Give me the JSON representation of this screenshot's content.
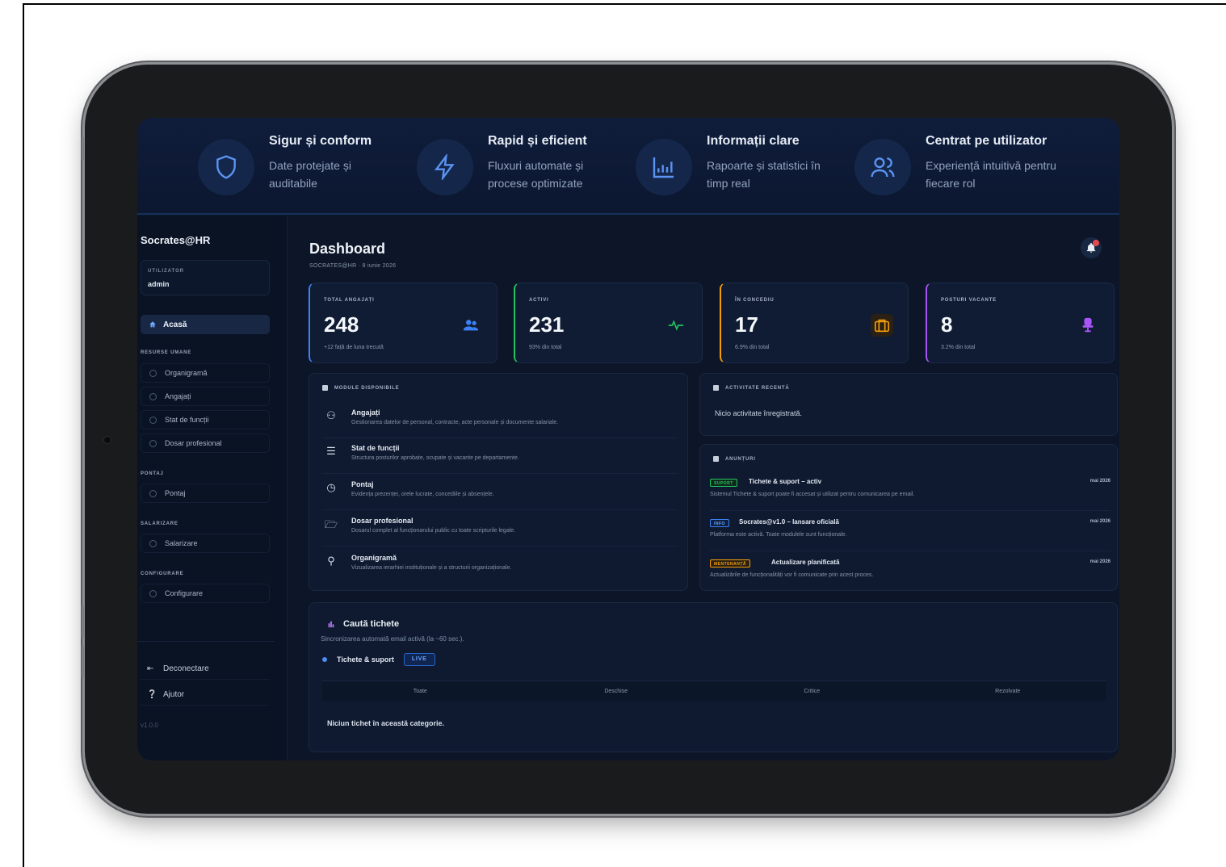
{
  "features": [
    {
      "icon": "shield-icon",
      "title": "Sigur și conform",
      "desc": "Date protejate și auditabile"
    },
    {
      "icon": "lightning-icon",
      "title": "Rapid și eficient",
      "desc": "Fluxuri automate și procese optimizate"
    },
    {
      "icon": "bar-chart-icon",
      "title": "Informații clare",
      "desc": "Rapoarte și statistici în timp real"
    },
    {
      "icon": "users-icon",
      "title": "Centrat pe utilizator",
      "desc": "Experiență intuitivă pentru fiecare rol"
    }
  ],
  "sidebar": {
    "brand": "Socrates@HR",
    "user_label": "UTILIZATOR",
    "user_value": "admin",
    "home": "Acasă",
    "sections": [
      {
        "title": "RESURSE UMANE",
        "items": [
          "Organigramă",
          "Angajați",
          "Stat de funcții",
          "Dosar profesional"
        ]
      },
      {
        "title": "PONTAJ",
        "items": [
          "Pontaj"
        ]
      },
      {
        "title": "SALARIZARE",
        "items": [
          "Salarizare"
        ]
      },
      {
        "title": "CONFIGURARE",
        "items": [
          "Configurare"
        ]
      }
    ],
    "logout": "Deconectare",
    "help": "Ajutor",
    "version": "v1.0.0"
  },
  "header": {
    "title": "Dashboard",
    "subtitle": "SOCRATES@HR · 8 iunie 2026"
  },
  "stats": [
    {
      "label": "TOTAL ANGAJAȚI",
      "value": "248",
      "note": "+12 față de luna trecută",
      "accent": "#3b82f6",
      "icon": "users-icon"
    },
    {
      "label": "ACTIVI",
      "value": "231",
      "note": "93% din total",
      "accent": "#22c55e",
      "icon": "activity-icon"
    },
    {
      "label": "ÎN CONCEDIU",
      "value": "17",
      "note": "6.9% din total",
      "accent": "#f59e0b",
      "icon": "briefcase-icon"
    },
    {
      "label": "POSTURI VACANTE",
      "value": "8",
      "note": "3.2% din total",
      "accent": "#a855f7",
      "icon": "chair-icon"
    }
  ],
  "modules": {
    "heading": "MODULE DISPONIBILE",
    "items": [
      {
        "icon": "people-icon",
        "title": "Angajați",
        "desc": "Gestionarea datelor de personal, contracte, acte personale și documente salariale."
      },
      {
        "icon": "list-icon",
        "title": "Stat de funcții",
        "desc": "Structura posturilor aprobate, ocupate și vacante pe departamente."
      },
      {
        "icon": "clock-icon",
        "title": "Pontaj",
        "desc": "Evidența prezenței, orele lucrate, concediile și absențele."
      },
      {
        "icon": "folder-icon",
        "title": "Dosar profesional",
        "desc": "Dosarul complet al funcționarului public cu toate scripturile legale."
      },
      {
        "icon": "org-chart-icon",
        "title": "Organigramă",
        "desc": "Vizualizarea ierarhiei instituționale și a structurii organizaționale."
      }
    ]
  },
  "activity": {
    "heading": "ACTIVITATE RECENTĂ",
    "empty": "Nicio activitate înregistrată."
  },
  "announcements": {
    "heading": "ANUNȚURI",
    "items": [
      {
        "tag": "SUPORT",
        "tag_color": "#22c55e",
        "title": "Tichete & suport – activ",
        "desc": "Sistemul Tichete & suport poate fi accesat și utilizat pentru comunicarea pe email.",
        "date": "mai 2026"
      },
      {
        "tag": "INFO",
        "tag_color": "#3b82f6",
        "title": "Socrates@v1.0 – lansare oficială",
        "desc": "Platforma este activă. Toate modulele sunt funcționale.",
        "date": "mai 2026"
      },
      {
        "tag": "MENTENANȚĂ",
        "tag_color": "#f59e0b",
        "title": "Actualizare planificată",
        "desc": "Actualizările de funcționalități vor fi comunicate prin acest proces.",
        "date": "mai 2026"
      }
    ]
  },
  "tickets": {
    "title": "Caută tichete",
    "subtitle": "Sincronizarea automată email activă (la ~60 sec.).",
    "source": "Tichete & suport",
    "live": "LIVE",
    "tabs": [
      "Toate",
      "Deschise",
      "Critice",
      "Rezolvate"
    ],
    "empty": "Niciun tichet în această categorie."
  }
}
